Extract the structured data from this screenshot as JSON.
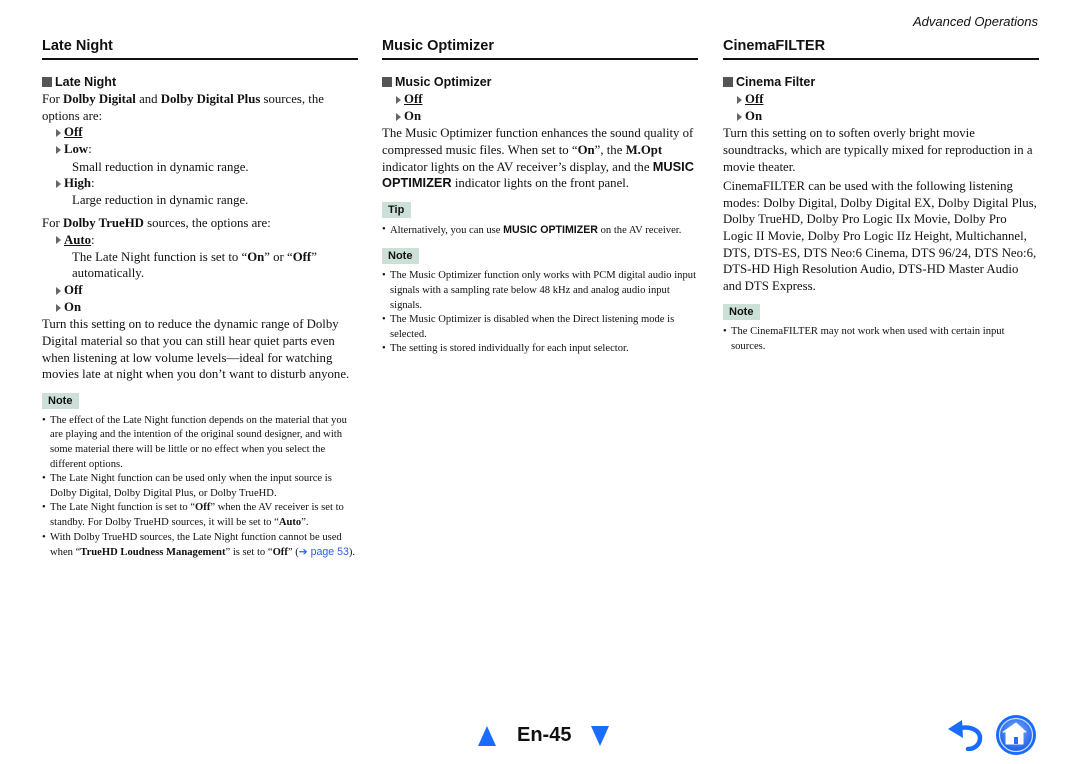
{
  "header": {
    "section": "Advanced Operations"
  },
  "late_night": {
    "title": "Late Night",
    "subtitle": "Late Night",
    "intro_pre": "For ",
    "intro_b1": "Dolby Digital",
    "intro_mid": " and ",
    "intro_b2": "Dolby Digital Plus",
    "intro_post": " sources, the options are:",
    "options_dd": [
      {
        "label": "Off",
        "default": true,
        "desc": ""
      },
      {
        "label": "Low",
        "default": false,
        "desc": "Small reduction in dynamic range."
      },
      {
        "label": "High",
        "default": false,
        "desc": "Large reduction in dynamic range."
      }
    ],
    "truehd_pre": "For ",
    "truehd_b": "Dolby TrueHD",
    "truehd_post": " sources, the options are:",
    "auto_label": "Auto",
    "auto_desc_pre": "The Late Night function is set to “",
    "auto_desc_on": "On",
    "auto_desc_mid": "” or “",
    "auto_desc_off": "Off",
    "auto_desc_post": "” automatically.",
    "opt_off": "Off",
    "opt_on": "On",
    "body": "Turn this setting on to reduce the dynamic range of Dolby Digital material so that you can still hear quiet parts even when listening at low volume levels—ideal for watching movies late at night when you don’t want to disturb anyone.",
    "note_label": "Note",
    "notes": {
      "n1": "The effect of the Late Night function depends on the material that you are playing and the intention of the original sound designer, and with some material there will be little or no effect when you select the different options.",
      "n2": "The Late Night function can be used only when the input source is Dolby Digital, Dolby Digital Plus, or Dolby TrueHD.",
      "n3_pre": "The Late Night function is set to “",
      "n3_b1": "Off",
      "n3_mid": "” when the AV receiver is set to standby. For Dolby TrueHD sources, it will be set to “",
      "n3_b2": "Auto",
      "n3_post": "”.",
      "n4_pre": "With Dolby TrueHD sources, the Late Night function cannot be used when “",
      "n4_b1": "TrueHD Loudness Management",
      "n4_mid": "” is set to “",
      "n4_b2": "Off",
      "n4_post1": "” (",
      "n4_link": "➔ page 53",
      "n4_post2": ")."
    }
  },
  "music_optimizer": {
    "title": "Music Optimizer",
    "subtitle": "Music Optimizer",
    "opt_off": "Off",
    "opt_on": "On",
    "body_pre": "The Music Optimizer function enhances the sound quality of compressed music files. When set to “",
    "body_on": "On",
    "body_mid": "”, the ",
    "body_mopt": "M.Opt",
    "body_mid2": " indicator lights on the AV receiver’s display, and the ",
    "body_sans": "MUSIC OPTIMIZER",
    "body_post": " indicator lights on the front panel.",
    "tip_label": "Tip",
    "tip_pre": "Alternatively, you can use ",
    "tip_b": "MUSIC OPTIMIZER",
    "tip_post": " on the AV receiver.",
    "note_label": "Note",
    "notes": [
      "The Music Optimizer function only works with PCM digital audio input signals with a sampling rate below 48 kHz and analog audio input signals.",
      "The Music Optimizer is disabled when the Direct listening mode is selected.",
      "The setting is stored individually for each input selector."
    ]
  },
  "cinema_filter": {
    "title": "CinemaFILTER",
    "subtitle": "Cinema Filter",
    "opt_off": "Off",
    "opt_on": "On",
    "body1": "Turn this setting on to soften overly bright movie soundtracks, which are typically mixed for reproduction in a movie theater.",
    "body2": "CinemaFILTER can be used with the following listening modes: Dolby Digital, Dolby Digital EX, Dolby Digital Plus, Dolby TrueHD, Dolby Pro Logic IIx Movie, Dolby Pro Logic II Movie, Dolby Pro Logic IIz Height, Multichannel, DTS, DTS-ES, DTS Neo:6 Cinema, DTS 96/24, DTS Neo:6, DTS-HD High Resolution Audio, DTS-HD Master Audio and DTS Express.",
    "note_label": "Note",
    "notes": [
      "The CinemaFILTER may not work when used with certain input sources."
    ]
  },
  "footer": {
    "page_number": "En-45",
    "icons": {
      "prev": "triangle-up-icon",
      "next": "triangle-down-icon",
      "back": "return-arrow-icon",
      "home": "home-icon"
    },
    "accent_color": "#1a6cff"
  }
}
